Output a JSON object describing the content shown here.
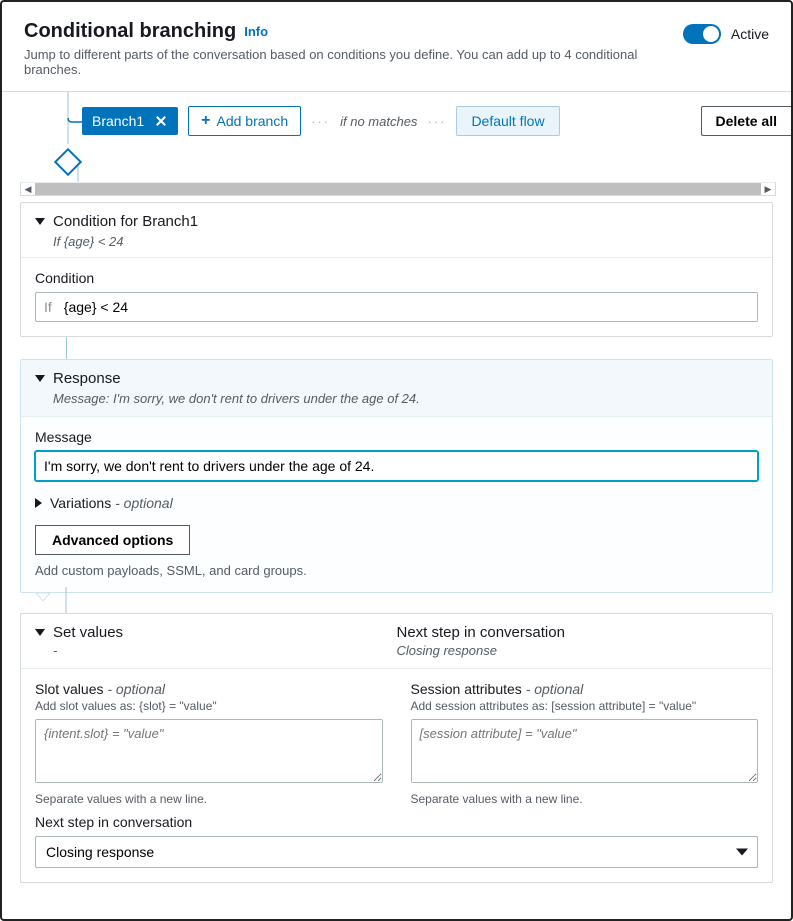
{
  "header": {
    "title": "Conditional branching",
    "info": "Info",
    "subtitle": "Jump to different parts of the conversation based on conditions you define. You can add up to 4 conditional branches.",
    "active_label": "Active"
  },
  "toolbar": {
    "branch_name": "Branch1",
    "add_branch": "Add branch",
    "no_match": "if no matches",
    "default_flow": "Default flow",
    "delete_all": "Delete all"
  },
  "condition": {
    "panel_title": "Condition for Branch1",
    "summary": "If {age} < 24",
    "field_label": "Condition",
    "prefix": "If",
    "value": "{age} < 24"
  },
  "response": {
    "panel_title": "Response",
    "summary": "Message: I'm sorry, we don't rent to drivers under the age of 24.",
    "message_label": "Message",
    "message_value": "I'm sorry, we don't rent to drivers under the age of 24.",
    "variations_label": "Variations",
    "variations_optional": "- optional",
    "advanced_button": "Advanced options",
    "advanced_help": "Add custom payloads, SSML, and card groups."
  },
  "setvalues": {
    "panel_title": "Set values",
    "placeholder_dash": "-",
    "next_step_title": "Next step in conversation",
    "next_step_sub": "Closing response",
    "slot": {
      "label": "Slot values",
      "optional": "- optional",
      "help": "Add slot values as: {slot} = \"value\"",
      "placeholder": "{intent.slot} = \"value\"",
      "footnote": "Separate values with a new line."
    },
    "session": {
      "label": "Session attributes",
      "optional": "- optional",
      "help": "Add session attributes as: [session attribute] = \"value\"",
      "placeholder": "[session attribute] = \"value\"",
      "footnote": "Separate values with a new line."
    },
    "next_label": "Next step in conversation",
    "next_value": "Closing response"
  }
}
